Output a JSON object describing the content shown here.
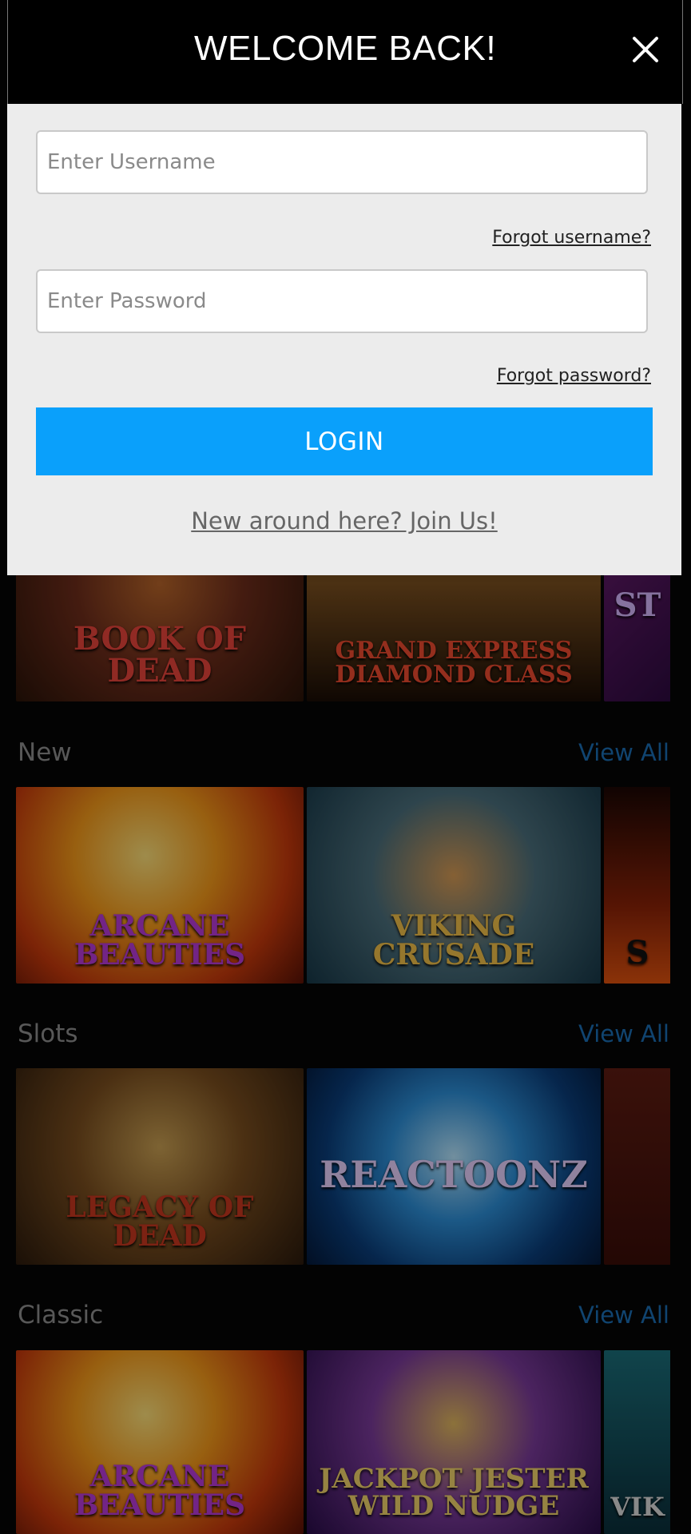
{
  "modal": {
    "title": "WELCOME BACK!",
    "close_icon": "close-icon",
    "username_placeholder": "Enter Username",
    "forgot_username": "Forgot username?",
    "password_placeholder": "Enter Password",
    "forgot_password": "Forgot password?",
    "login_label": "LOGIN",
    "join_label": "New around here? Join Us!",
    "accent_color": "#0aa0fb"
  },
  "lobby": {
    "top_row": [
      {
        "name": "BOOK OF DEAD"
      },
      {
        "name": "GRAND EXPRESS DIAMOND CLASS"
      },
      {
        "name": "ST"
      }
    ],
    "sections": [
      {
        "title": "New",
        "view_all": "View All",
        "games": [
          {
            "name": "ARCANE BEAUTIES"
          },
          {
            "name": "VIKING CRUSADE"
          },
          {
            "name": "S"
          }
        ]
      },
      {
        "title": "Slots",
        "view_all": "View All",
        "games": [
          {
            "name": "LEGACY OF DEAD"
          },
          {
            "name": "REACTOONZ"
          },
          {
            "name": ""
          }
        ]
      },
      {
        "title": "Classic",
        "view_all": "View All",
        "games": [
          {
            "name": "ARCANE BEAUTIES"
          },
          {
            "name": "JACKPOT JESTER WILD NUDGE"
          },
          {
            "name": "VIK"
          }
        ]
      }
    ]
  }
}
